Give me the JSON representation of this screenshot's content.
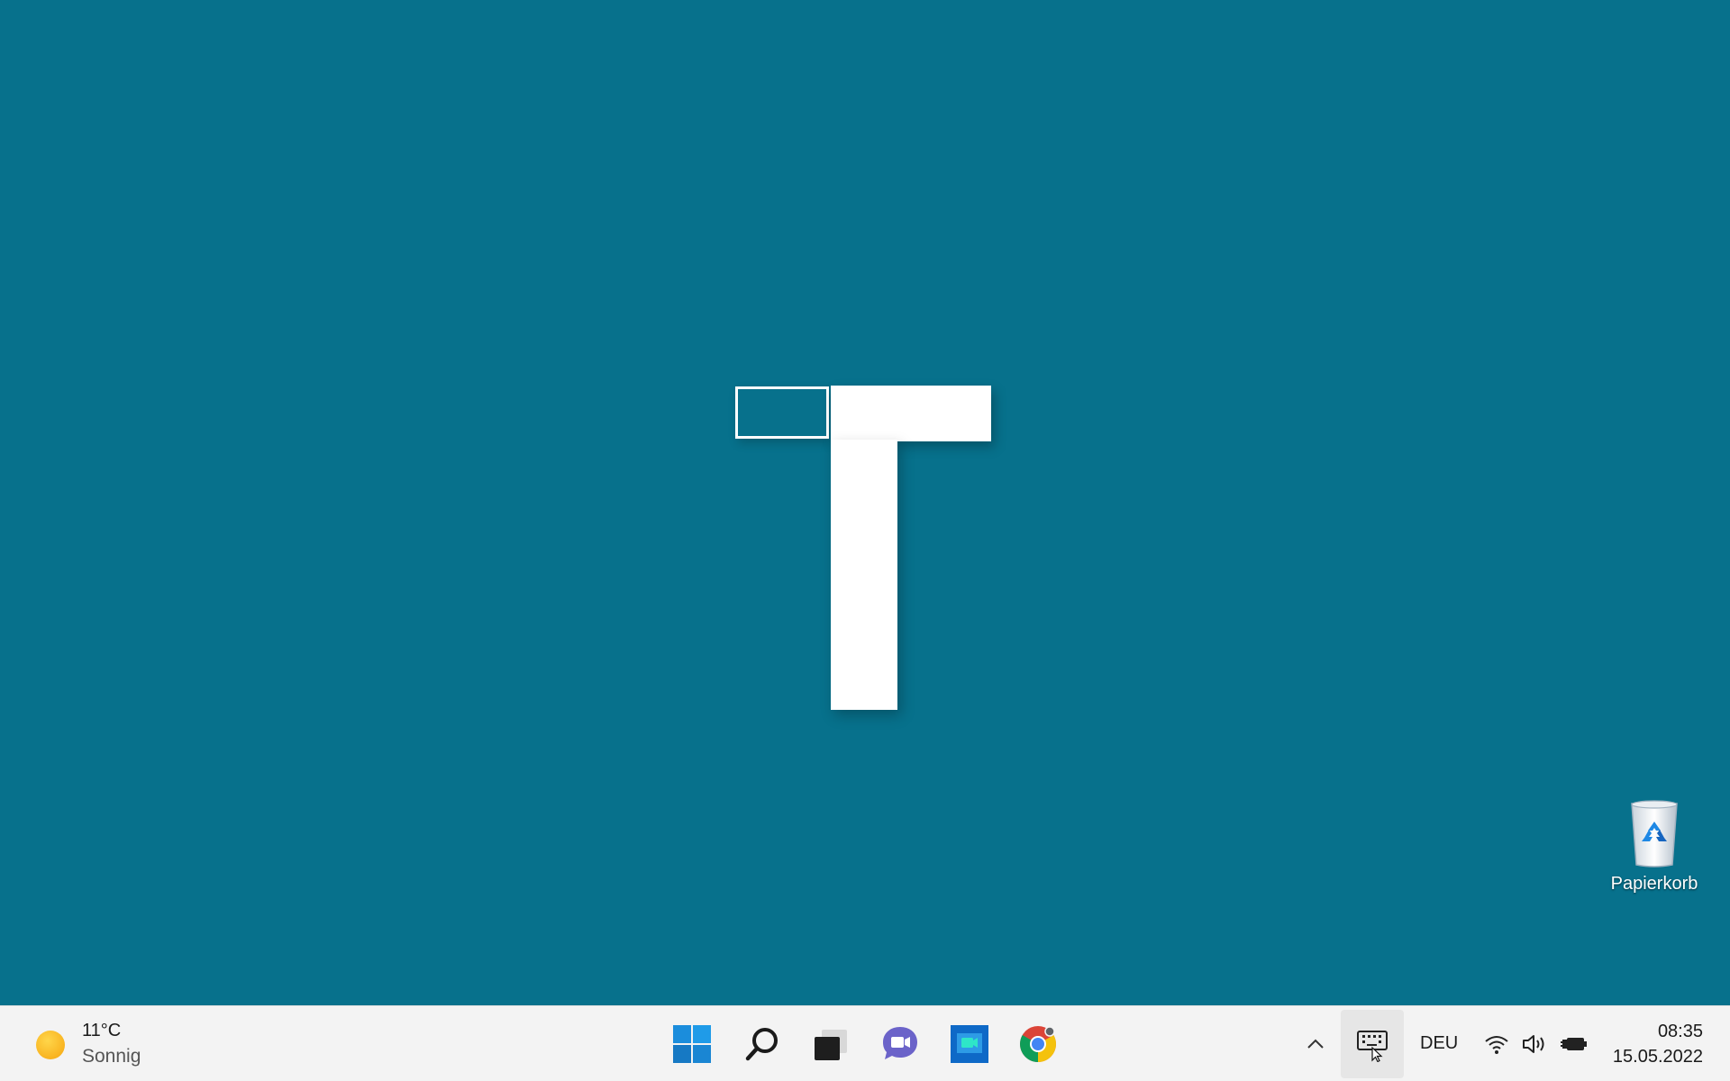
{
  "desktop": {
    "background_color": "#07718c",
    "logo": "T",
    "icons": [
      {
        "label": "Papierkorb",
        "icon": "recycle-bin-icon"
      }
    ]
  },
  "taskbar": {
    "weather": {
      "temperature": "11°C",
      "condition": "Sonnig",
      "icon": "sun-icon"
    },
    "pinned": [
      {
        "name": "start-button",
        "icon": "windows-icon"
      },
      {
        "name": "search-button",
        "icon": "search-icon"
      },
      {
        "name": "task-view-button",
        "icon": "task-view-icon"
      },
      {
        "name": "teams-chat-button",
        "icon": "teams-chat-icon"
      },
      {
        "name": "meet-now-button",
        "icon": "meet-now-icon"
      },
      {
        "name": "chrome-button",
        "icon": "chrome-icon"
      }
    ],
    "tray": {
      "language": "DEU",
      "time": "08:35",
      "date": "15.05.2022"
    }
  }
}
